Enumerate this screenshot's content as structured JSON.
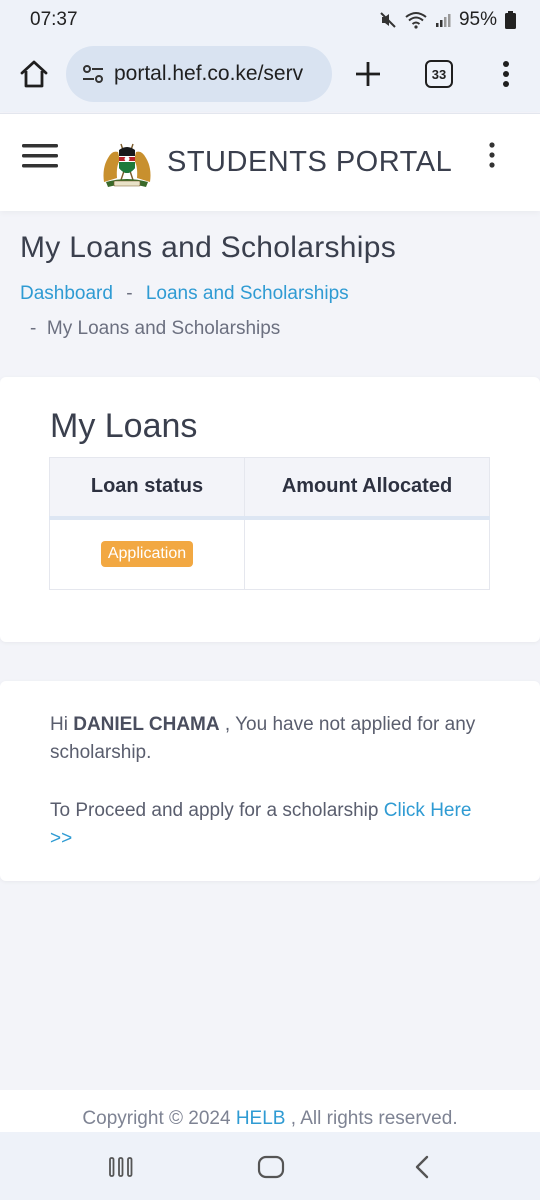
{
  "status_bar": {
    "time": "07:37",
    "battery": "95%",
    "icons": [
      "mute-icon",
      "wifi-icon",
      "signal-icon",
      "battery-icon"
    ]
  },
  "browser": {
    "url": "portal.hef.co.ke/serv",
    "tab_count": "33",
    "icons": [
      "home-icon",
      "site-settings-icon",
      "new-tab-icon",
      "tab-switcher-icon",
      "more-icon"
    ]
  },
  "header": {
    "title": "STUDENTS PORTAL",
    "icons": [
      "hamburger-icon",
      "coat-of-arms-logo",
      "kebab-menu-icon"
    ]
  },
  "page": {
    "title": "My Loans and Scholarships",
    "breadcrumb": {
      "items": [
        "Dashboard",
        "Loans and Scholarships",
        "My Loans and Scholarships"
      ],
      "separator": "-"
    }
  },
  "loans": {
    "heading": "My Loans",
    "columns": [
      "Loan status",
      "Amount Allocated"
    ],
    "rows": [
      {
        "status": "Application",
        "amount": ""
      }
    ]
  },
  "scholarship": {
    "greeting": "Hi",
    "user_name": "DANIEL CHAMA",
    "message": ", You have not applied for any scholarship.",
    "proceed_text": "To Proceed and apply for a scholarship",
    "link_text": "Click Here >>"
  },
  "footer": {
    "prefix": "Copyright © 2024",
    "brand": "HELB",
    "suffix": ", All rights reserved."
  },
  "colors": {
    "accent": "#2f9bd3",
    "badge": "#f2a842",
    "page_bg": "#f3f4f9",
    "chrome_bg": "#eef2f9"
  }
}
